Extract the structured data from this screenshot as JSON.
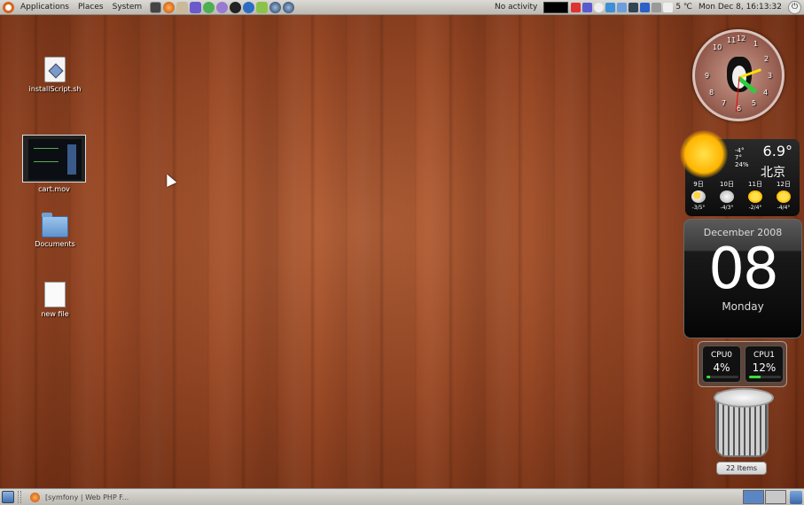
{
  "top_panel": {
    "menus": [
      "Applications",
      "Places",
      "System"
    ],
    "launcher_icons": [
      "terminal-icon",
      "firefox-icon",
      "bug-icon",
      "gear-icon",
      "messenger-icon",
      "chat-icon",
      "qq-icon",
      "qq-icon-2",
      "software-icon",
      "blue-globe-icon",
      "blue-globe-icon-2"
    ],
    "activity": "No activity",
    "clock": "Mon Dec  8, 16:13:32",
    "temperature": "5 ℃"
  },
  "desktop_icons": [
    {
      "label": "installScript.sh",
      "icon": "shell-script-icon"
    },
    {
      "label": "cart.mov",
      "icon": "video-thumbnail-icon"
    },
    {
      "label": "Documents",
      "icon": "folder-icon"
    },
    {
      "label": "new file",
      "icon": "text-file-icon"
    }
  ],
  "clock_widget": {
    "numbers": [
      "10",
      "11",
      "12",
      "1",
      "2",
      "3",
      "4",
      "5",
      "6",
      "7",
      "8",
      "9"
    ],
    "time": "16:13:32"
  },
  "weather": {
    "temp": "6.9°",
    "city": "北京",
    "low": "-4°",
    "high": "7°",
    "humidity": "24%",
    "forecast": [
      {
        "day": "9日",
        "range": "-3/5°",
        "icon": "partly-cloudy-icon"
      },
      {
        "day": "10日",
        "range": "-4/3°",
        "icon": "snow-cloud-icon"
      },
      {
        "day": "11日",
        "range": "-2/4°",
        "icon": "sun-icon"
      },
      {
        "day": "12日",
        "range": "-4/4°",
        "icon": "sun-icon"
      }
    ]
  },
  "calendar": {
    "month_year": "December 2008",
    "day": "08",
    "weekday": "Monday"
  },
  "cpu": [
    {
      "name": "CPU0",
      "value": "4%",
      "load": 0.04
    },
    {
      "name": "CPU1",
      "value": "12%",
      "load": 0.12
    }
  ],
  "trash": {
    "count": "22 Items"
  },
  "bottom_panel": {
    "task_title": "[symfony | Web PHP F..."
  },
  "colors": {
    "wood": "#9b4a26",
    "panel": "#cfcdc8",
    "cpu_bar": "#39e039"
  }
}
